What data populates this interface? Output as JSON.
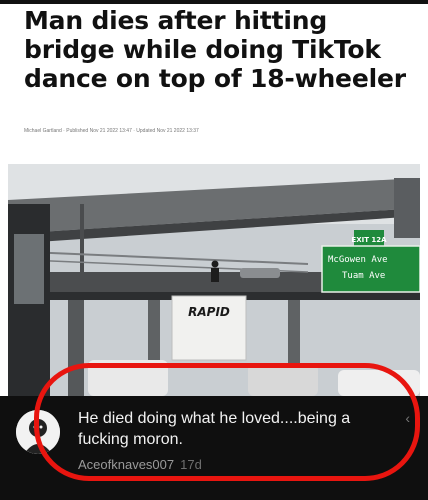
{
  "article": {
    "headline": "Man dies after hitting bridge while doing TikTok dance on top of 18-wheeler",
    "byline": "Michael Gartland  ·  Published Nov 21 2022 13:47  ·  Updated Nov 21 2022 13:37"
  },
  "photo": {
    "sign_exit": "EXIT 12A",
    "sign_street_1": "McGowen Ave",
    "sign_street_2": "Tuam Ave",
    "truck_brand": "RAPID"
  },
  "comment": {
    "text": "He died doing what he loved....being a fucking moron.",
    "username": "Aceofknaves007",
    "age": "17d"
  },
  "colors": {
    "highlight": "#e8150f",
    "comment_bg": "#0f0f0f",
    "sign_green": "#1f8a3c"
  }
}
